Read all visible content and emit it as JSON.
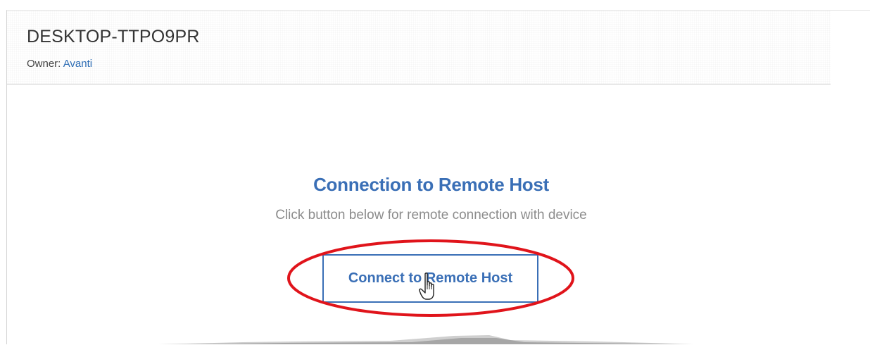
{
  "device": {
    "name": "DESKTOP-TTPO9PR",
    "owner_label": "Owner:",
    "owner_name": "Avanti"
  },
  "remote": {
    "title": "Connection to Remote Host",
    "subtitle": "Click button below for remote connection with device",
    "button_label": "Connect to Remote Host"
  },
  "colors": {
    "accent": "#3a6fb6",
    "highlight_ring": "#e0141b",
    "subtitle_text": "#8c8c8c"
  },
  "icons": {
    "cursor": "hand-pointer-icon"
  }
}
